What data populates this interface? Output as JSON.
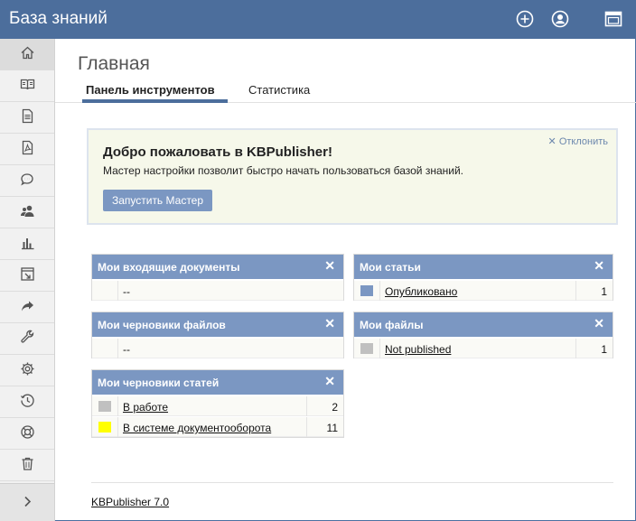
{
  "app": {
    "title": "База знаний"
  },
  "topbar": {
    "icons": [
      "add-circle-icon",
      "user-circle-icon",
      "window-icon"
    ]
  },
  "sidebar": {
    "items": [
      {
        "icon": "home-icon"
      },
      {
        "icon": "book-icon"
      },
      {
        "icon": "document-icon"
      },
      {
        "icon": "pdf-file-icon"
      },
      {
        "icon": "chat-bubbles-icon"
      },
      {
        "icon": "users-icon"
      },
      {
        "icon": "bar-chart-icon"
      },
      {
        "icon": "import-icon"
      },
      {
        "icon": "share-arrow-icon"
      },
      {
        "icon": "wrench-icon"
      },
      {
        "icon": "settings-gear-icon"
      },
      {
        "icon": "clock-history-icon"
      },
      {
        "icon": "lifebuoy-icon"
      },
      {
        "icon": "trash-icon"
      }
    ],
    "expand_icon": "chevron-right-icon"
  },
  "page": {
    "title": "Главная",
    "tabs": [
      {
        "label": "Панель инструментов",
        "active": true
      },
      {
        "label": "Статистика",
        "active": false
      }
    ]
  },
  "welcome": {
    "title": "Добро пожаловать в KBPublisher!",
    "text": "Мастер настройки позволит быстро начать пользоваться базой знаний.",
    "button": "Запустить Мастер",
    "dismiss": "Отклонить"
  },
  "widgets": {
    "incoming": {
      "title": "Мои входящие документы",
      "empty": "--"
    },
    "file_drafts": {
      "title": "Мои черновики файлов",
      "empty": "--"
    },
    "article_drafts": {
      "title": "Мои черновики статей",
      "rows": [
        {
          "label": "В работе",
          "count": "2",
          "color": "#c0c0c0"
        },
        {
          "label": "В системе документооборота",
          "count": "11",
          "color": "#ffff00"
        }
      ]
    },
    "articles": {
      "title": "Мои статьи",
      "rows": [
        {
          "label": "Опубликовано",
          "count": "1",
          "color": "#7b97c2"
        }
      ]
    },
    "files": {
      "title": "Мои файлы",
      "rows": [
        {
          "label": "Not published",
          "count": "1",
          "color": "#c0c0c0"
        }
      ]
    }
  },
  "footer": {
    "link": "KBPublisher 7.0"
  }
}
